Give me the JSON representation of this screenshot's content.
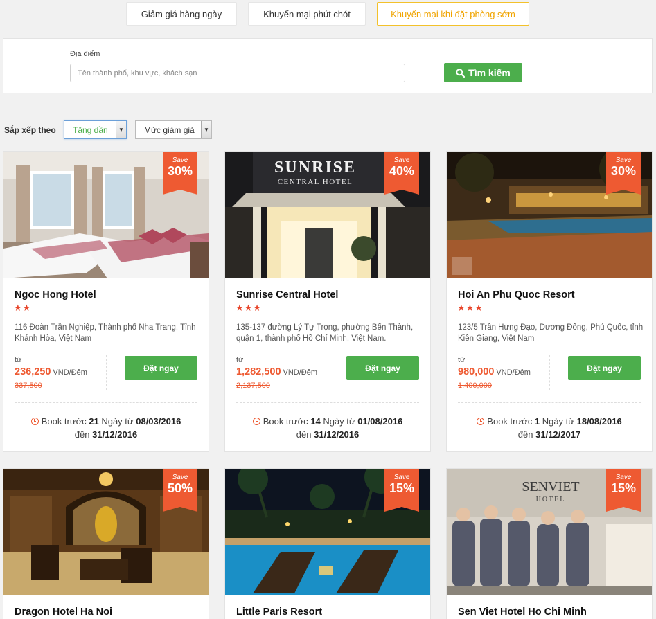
{
  "tabs": [
    {
      "label": "Giảm giá hàng ngày",
      "active": false
    },
    {
      "label": "Khuyến mại phút chót",
      "active": false
    },
    {
      "label": "Khuyến mại khi đặt phòng sớm",
      "active": true
    }
  ],
  "search": {
    "label": "Địa điểm",
    "placeholder": "Tên thành phố, khu vực, khách sạn",
    "button_label": "Tìm kiếm",
    "button_icon": "search-icon"
  },
  "sort": {
    "label": "Sắp xếp theo",
    "order_value": "Tăng dần",
    "criteria_value": "Mức giảm giá"
  },
  "colors": {
    "accent_green": "#4cae4c",
    "accent_orange": "#ee5a32",
    "active_tab": "#f3c12b"
  },
  "cards": [
    {
      "save_label": "Save",
      "discount": "30%",
      "name": "Ngoc Hong Hotel",
      "stars": "★★",
      "star_count": 2,
      "address": "116 Đoàn Trần Nghiệp, Thành phố Nha Trang, Tỉnh Khánh Hòa, Việt Nam",
      "from_label": "từ",
      "price": "236,250",
      "unit": "VND/Đêm",
      "old_price": "337,500",
      "book_label": "Đặt ngay",
      "v_prefix": "Book trước",
      "v_days": "21",
      "v_mid": "Ngày từ",
      "v_from": "08/03/2016",
      "v_to_label": "đến",
      "v_to": "31/12/2016"
    },
    {
      "save_label": "Save",
      "discount": "40%",
      "name": "Sunrise Central Hotel",
      "stars": "★★★",
      "star_count": 3,
      "address": "135-137 đường Lý Tự Trọng, phường Bến Thành, quận 1, thành phố Hồ Chí Minh, Việt Nam.",
      "from_label": "từ",
      "price": "1,282,500",
      "unit": "VND/Đêm",
      "old_price": "2,137,500",
      "book_label": "Đặt ngay",
      "v_prefix": "Book trước",
      "v_days": "14",
      "v_mid": "Ngày từ",
      "v_from": "01/08/2016",
      "v_to_label": "đến",
      "v_to": "31/12/2016",
      "image_sign": "SUNRISE",
      "image_sign_sub": "CENTRAL HOTEL"
    },
    {
      "save_label": "Save",
      "discount": "30%",
      "name": "Hoi An Phu Quoc Resort",
      "stars": "★★★",
      "star_count": 3,
      "address": "123/5 Trần Hưng Đạo, Dương Đông, Phú Quốc, tỉnh Kiên Giang, Việt Nam",
      "from_label": "từ",
      "price": "980,000",
      "unit": "VND/Đêm",
      "old_price": "1,400,000",
      "book_label": "Đặt ngay",
      "v_prefix": "Book trước",
      "v_days": "1",
      "v_mid": "Ngày từ",
      "v_from": "18/08/2016",
      "v_to_label": "đến",
      "v_to": "31/12/2017"
    },
    {
      "save_label": "Save",
      "discount": "50%",
      "name": "Dragon Hotel Ha Noi"
    },
    {
      "save_label": "Save",
      "discount": "15%",
      "name": "Little Paris Resort"
    },
    {
      "save_label": "Save",
      "discount": "15%",
      "name": "Sen Viet Hotel Ho Chi Minh",
      "image_sign": "SENVIET",
      "image_sign_sub": "HOTEL"
    }
  ]
}
